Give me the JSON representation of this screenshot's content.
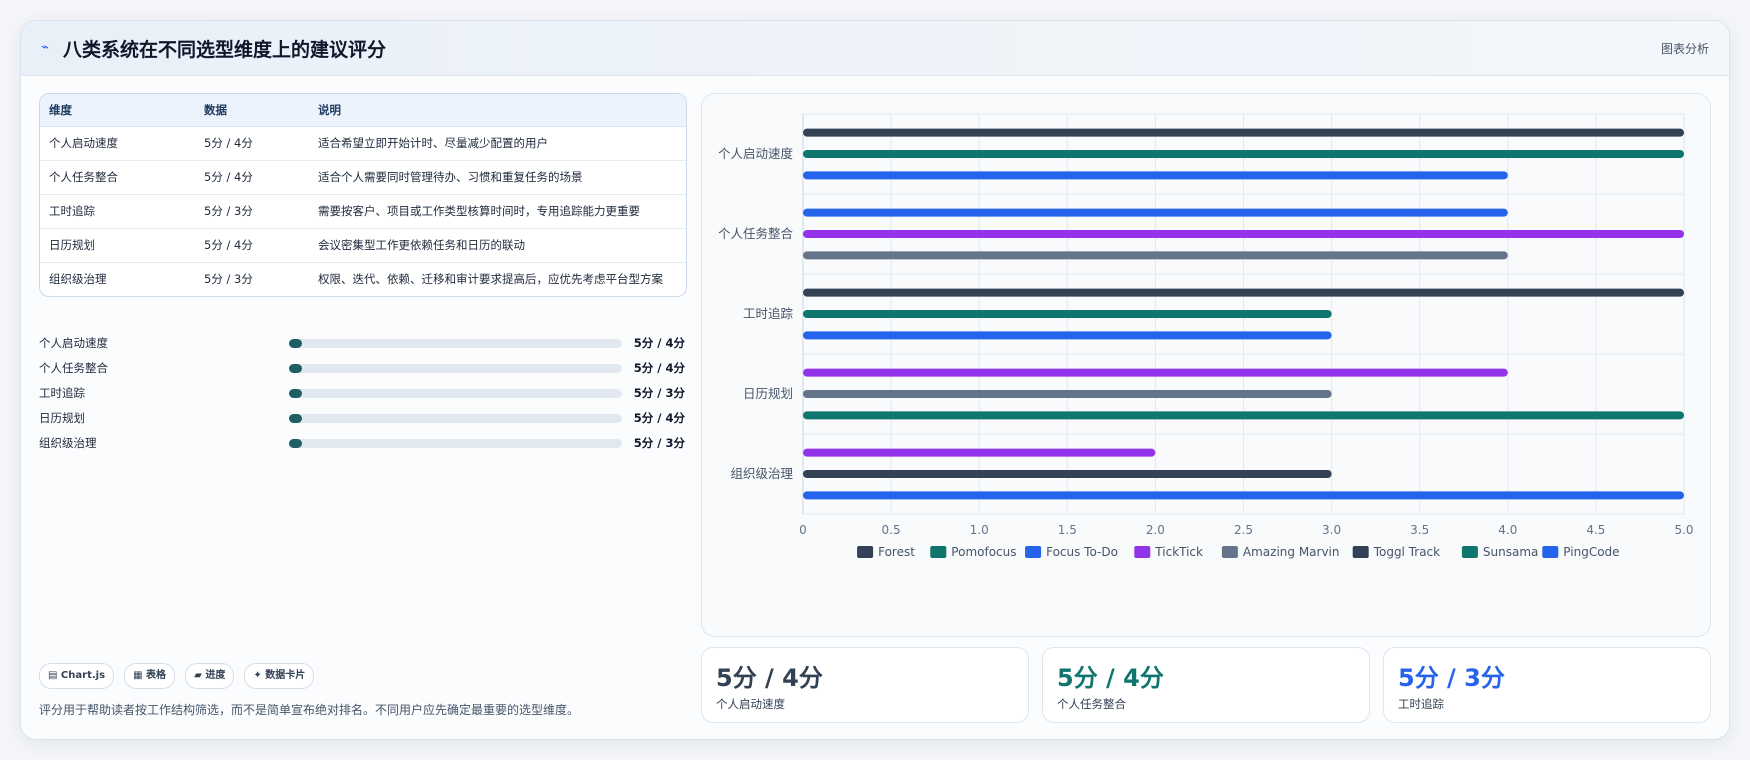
{
  "header": {
    "icon": "trend-icon",
    "icon_glyph": "⌁",
    "title": "八类系统在不同选型维度上的建议评分",
    "action_label": "图表分析"
  },
  "table": {
    "headers": [
      "维度",
      "数据",
      "说明"
    ],
    "rows": [
      [
        "个人启动速度",
        "5分 / 4分",
        "适合希望立即开始计时、尽量减少配置的用户"
      ],
      [
        "个人任务整合",
        "5分 / 4分",
        "适合个人需要同时管理待办、习惯和重复任务的场景"
      ],
      [
        "工时追踪",
        "5分 / 3分",
        "需要按客户、项目或工作类型核算时间时，专用追踪能力更重要"
      ],
      [
        "日历规划",
        "5分 / 4分",
        "会议密集型工作更依赖任务和日历的联动"
      ],
      [
        "组织级治理",
        "5分 / 3分",
        "权限、迭代、依赖、迁移和审计要求提高后，应优先考虑平台型方案"
      ]
    ]
  },
  "progress": [
    {
      "label": "个人启动速度",
      "value": "5分 / 4分",
      "fraction": 0.03
    },
    {
      "label": "个人任务整合",
      "value": "5分 / 4分",
      "fraction": 0.03
    },
    {
      "label": "工时追踪",
      "value": "5分 / 3分",
      "fraction": 0.03
    },
    {
      "label": "日历规划",
      "value": "5分 / 4分",
      "fraction": 0.03
    },
    {
      "label": "组织级治理",
      "value": "5分 / 3分",
      "fraction": 0.03
    }
  ],
  "chips": [
    "▤ Chart.js",
    "▦ 表格",
    "▰ 进度",
    "✦ 数据卡片"
  ],
  "footnote": "评分用于帮助读者按工作结构筛选，而不是简单宣布绝对排名。不同用户应先确定最重要的选型维度。",
  "stats": [
    {
      "value": "5分 / 4分",
      "label": "个人启动速度",
      "color": "#334155"
    },
    {
      "value": "5分 / 4分",
      "label": "个人任务整合",
      "color": "#0f766e"
    },
    {
      "value": "5分 / 3分",
      "label": "工时追踪",
      "color": "#2563eb"
    }
  ],
  "chart_data": {
    "type": "bar",
    "orientation": "horizontal",
    "categories": [
      "个人启动速度",
      "个人任务整合",
      "工时追踪",
      "日历规划",
      "组织级治理"
    ],
    "xlim": [
      0,
      5
    ],
    "x_ticks": [
      "0",
      "0.5",
      "1.0",
      "1.5",
      "2.0",
      "2.5",
      "3.0",
      "3.5",
      "4.0",
      "4.5",
      "5.0"
    ],
    "grid": true,
    "legend_position": "bottom",
    "series": [
      {
        "name": "Forest",
        "color": "#334155",
        "values": [
          5,
          null,
          null,
          null,
          null
        ]
      },
      {
        "name": "Pomofocus",
        "color": "#0f766e",
        "values": [
          5,
          null,
          null,
          null,
          null
        ]
      },
      {
        "name": "Focus To-Do",
        "color": "#2563eb",
        "values": [
          4,
          4,
          null,
          null,
          null
        ]
      },
      {
        "name": "TickTick",
        "color": "#9333ea",
        "values": [
          null,
          5,
          null,
          4,
          2
        ]
      },
      {
        "name": "Amazing Marvin",
        "color": "#64748b",
        "values": [
          null,
          4,
          null,
          3,
          null
        ]
      },
      {
        "name": "Toggl Track",
        "color": "#334155",
        "values": [
          null,
          null,
          5,
          null,
          3
        ]
      },
      {
        "name": "Sunsama",
        "color": "#0f766e",
        "values": [
          null,
          null,
          3,
          5,
          null
        ]
      },
      {
        "name": "PingCode",
        "color": "#2563eb",
        "values": [
          null,
          null,
          3,
          null,
          5
        ]
      }
    ]
  }
}
